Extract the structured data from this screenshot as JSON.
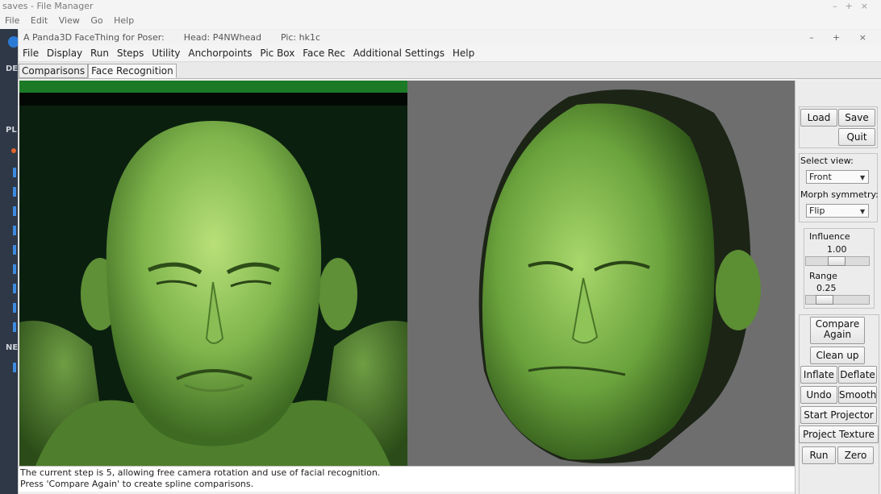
{
  "file_manager": {
    "title": "saves - File Manager",
    "menu": [
      "File",
      "Edit",
      "View",
      "Go",
      "Help"
    ],
    "sidebar_labels": [
      "DE",
      "PL",
      "NE"
    ]
  },
  "app": {
    "title_app": "A Panda3D FaceThing for Poser:",
    "title_head": "Head: P4NWhead",
    "title_pic": "Pic: hk1c",
    "window_controls": "– + ×",
    "menu": [
      "File",
      "Display",
      "Run",
      "Steps",
      "Utility",
      "Anchorpoints",
      "Pic Box",
      "Face Rec",
      "Additional Settings",
      "Help"
    ],
    "tabs": [
      "Comparisons",
      "Face Recognition"
    ],
    "active_tab": "Face Recognition"
  },
  "status": {
    "line1": "The current step is 5, allowing free camera rotation and use of facial recognition.",
    "line2": "Press 'Compare Again' to create spline comparisons."
  },
  "panel": {
    "load": "Load",
    "save": "Save",
    "quit": "Quit",
    "select_view_label": "Select view:",
    "select_view_value": "Front",
    "morph_symmetry_label": "Morph symmetry:",
    "morph_symmetry_value": "Flip",
    "influence_label": "Influence",
    "influence_value": "1.00",
    "range_label": "Range",
    "range_value": "0.25",
    "compare_again_1": "Compare",
    "compare_again_2": "Again",
    "clean_up": "Clean up",
    "inflate": "Inflate",
    "deflate": "Deflate",
    "undo": "Undo",
    "smooth": "Smooth",
    "start_projector": "Start Projector",
    "project_texture": "Project Texture",
    "run": "Run",
    "zero": "Zero"
  },
  "colors": {
    "face_green": "#7fb54c",
    "left_bg": "#0b1f0f",
    "right_bg": "#6e6e6e"
  }
}
